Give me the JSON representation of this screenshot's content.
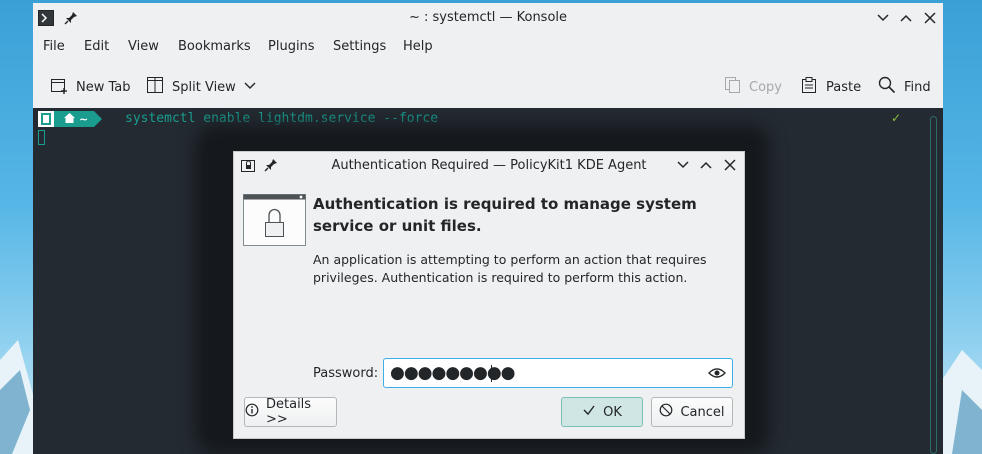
{
  "konsole": {
    "title": "~ : systemctl — Konsole",
    "menu": [
      "File",
      "Edit",
      "View",
      "Bookmarks",
      "Plugins",
      "Settings",
      "Help"
    ],
    "toolbar": {
      "new_tab": "New Tab",
      "split_view": "Split View",
      "copy": "Copy",
      "paste": "Paste",
      "find": "Find"
    },
    "terminal": {
      "prompt_dir": "~",
      "command": "systemctl enable lightdm.service --force",
      "status": "✓"
    }
  },
  "dialog": {
    "title": "Authentication Required — PolicyKit1 KDE Agent",
    "heading": "Authentication is required to manage system service or unit files.",
    "description": "An application is attempting to perform an action that requires privileges. Authentication is required to perform this action.",
    "password_label": "Password:",
    "password_mask": "●●●●●●●●●",
    "details_button": "Details >>",
    "ok_button": "OK",
    "cancel_button": "Cancel"
  },
  "colors": {
    "accent": "#3daee9",
    "terminal_bg": "#232a31",
    "terminal_text": "#1a9c8f",
    "ok_bg": "#cfe6e4"
  },
  "icons": {
    "app": "konsole-icon",
    "pin": "pin-icon",
    "minimize": "chevron-down-icon",
    "maximize": "chevron-up-icon",
    "close": "close-icon",
    "new_tab": "new-tab-icon",
    "split_view": "split-view-icon",
    "copy": "copy-icon",
    "paste": "paste-icon",
    "find": "search-icon",
    "lock": "lock-icon",
    "eye": "eye-icon",
    "info": "info-icon",
    "check": "check-icon",
    "cancel": "cancel-icon"
  }
}
